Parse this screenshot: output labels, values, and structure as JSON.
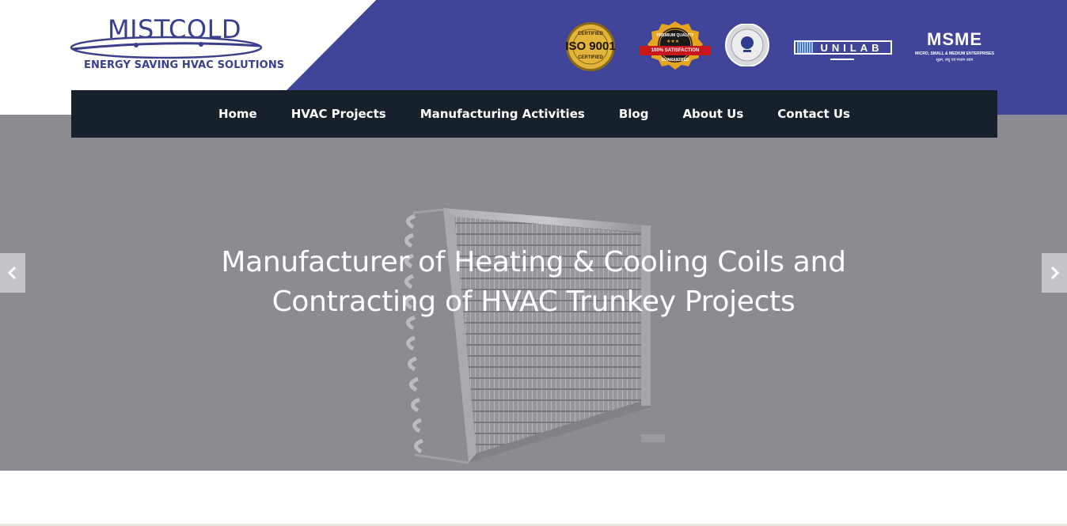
{
  "brand": {
    "name": "MISTCOLD",
    "tagline": "ENERGY SAVING HVAC SOLUTIONS",
    "colors": {
      "band": "#40459a",
      "nav": "#17212b",
      "logo": "#3a3f8c"
    }
  },
  "badges": {
    "iso": {
      "top": "CERTIFIED",
      "main": "ISO 9001",
      "bottom": "CERTIFIED"
    },
    "premium": {
      "top": "PREMIUM QUALITY",
      "ribbon": "100% SATISFACTION",
      "bottom": "GUARANTEED"
    },
    "certification": {
      "icon": "certification-seal-icon"
    },
    "unilab": {
      "text": "UNILAB"
    },
    "msme": {
      "title": "MSME",
      "subtitle": "MICRO, SMALL & MEDIUM ENTERPRISES",
      "subtitle_hindi": "सूक्ष्म, लघु एवं मध्यम उद्यम"
    }
  },
  "nav": {
    "items": [
      {
        "label": "Home"
      },
      {
        "label": "HVAC Projects"
      },
      {
        "label": "Manufacturing Activities"
      },
      {
        "label": "Blog"
      },
      {
        "label": "About Us"
      },
      {
        "label": "Contact Us"
      }
    ]
  },
  "hero": {
    "title_line1": "Manufacturer of Heating & Cooling Coils and",
    "title_line2": "Contracting of HVAC Trunkey Projects",
    "prev_icon": "chevron-left-icon",
    "next_icon": "chevron-right-icon"
  }
}
